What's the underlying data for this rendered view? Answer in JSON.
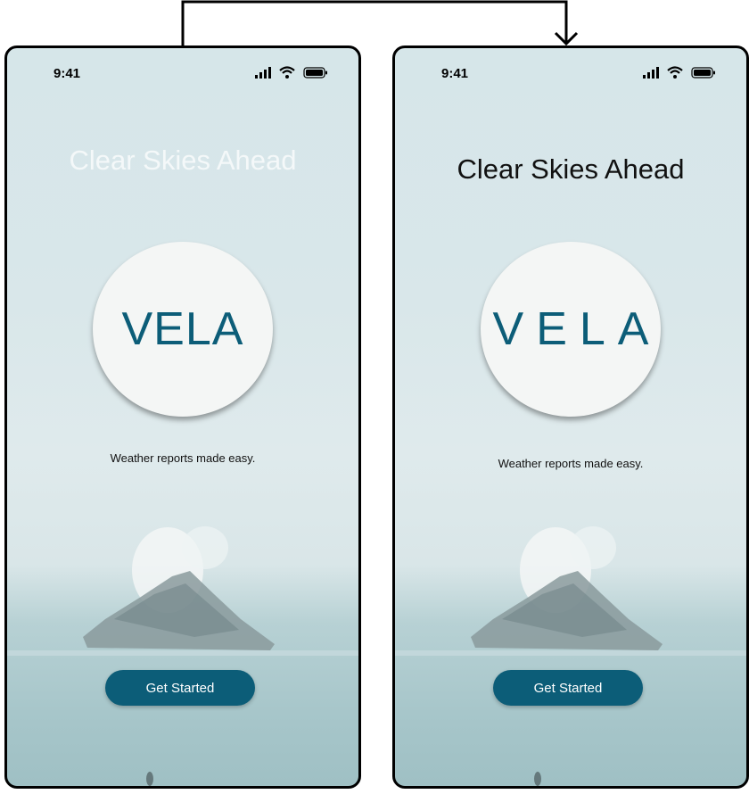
{
  "screens": {
    "before": {
      "status_time": "9:41",
      "title": "Clear Skies Ahead",
      "logo": "VELA",
      "tagline": "Weather reports made easy.",
      "cta_label": "Get Started"
    },
    "after": {
      "status_time": "9:41",
      "title": "Clear Skies Ahead",
      "logo": "VELA",
      "tagline": "Weather reports made easy.",
      "cta_label": "Get Started"
    }
  },
  "icons": {
    "status": [
      "signal-icon",
      "wifi-icon",
      "battery-icon"
    ],
    "connector": "arrow-down-icon"
  },
  "colors": {
    "brand": "#0c5d78",
    "logo_circle": "#f4f6f5",
    "sky": "#d6e6e9",
    "sea": "#a7c6ca"
  }
}
